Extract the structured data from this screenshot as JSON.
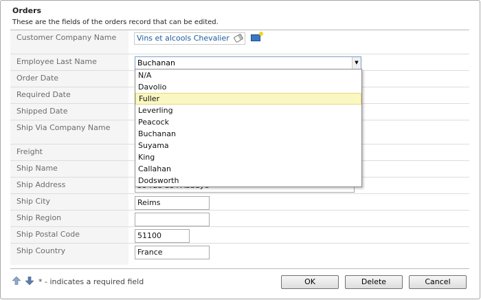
{
  "header": {
    "title": "Orders",
    "subtitle": "These are the fields of the orders record that can be edited."
  },
  "fields": [
    {
      "label": "Customer Company Name",
      "value": "Vins et alcools Chevalier"
    },
    {
      "label": "Employee Last Name",
      "value": "Buchanan"
    },
    {
      "label": "Order Date",
      "value": ""
    },
    {
      "label": "Required Date",
      "value": ""
    },
    {
      "label": "Shipped Date",
      "value": ""
    },
    {
      "label": "Ship Via Company Name",
      "value": ""
    },
    {
      "label": "Freight",
      "value": ""
    },
    {
      "label": "Ship Name",
      "value": ""
    },
    {
      "label": "Ship Address",
      "value": "59 rue de l'Abbaye"
    },
    {
      "label": "Ship City",
      "value": "Reims"
    },
    {
      "label": "Ship Region",
      "value": ""
    },
    {
      "label": "Ship Postal Code",
      "value": "51100"
    },
    {
      "label": "Ship Country",
      "value": "France"
    }
  ],
  "employee_dropdown": {
    "options": [
      "N/A",
      "Davolio",
      "Fuller",
      "Leverling",
      "Peacock",
      "Buchanan",
      "Suyama",
      "King",
      "Callahan",
      "Dodsworth"
    ],
    "highlighted": "Fuller"
  },
  "footer": {
    "required_note": "* - indicates a required field",
    "ok_label": "OK",
    "delete_label": "Delete",
    "cancel_label": "Cancel"
  },
  "icons": {
    "clear": "eraser-icon",
    "new": "new-record-icon",
    "up": "arrow-up-icon",
    "down": "arrow-down-icon"
  },
  "colors": {
    "link": "#1a5b9e",
    "highlight": "#fbf7c2"
  }
}
